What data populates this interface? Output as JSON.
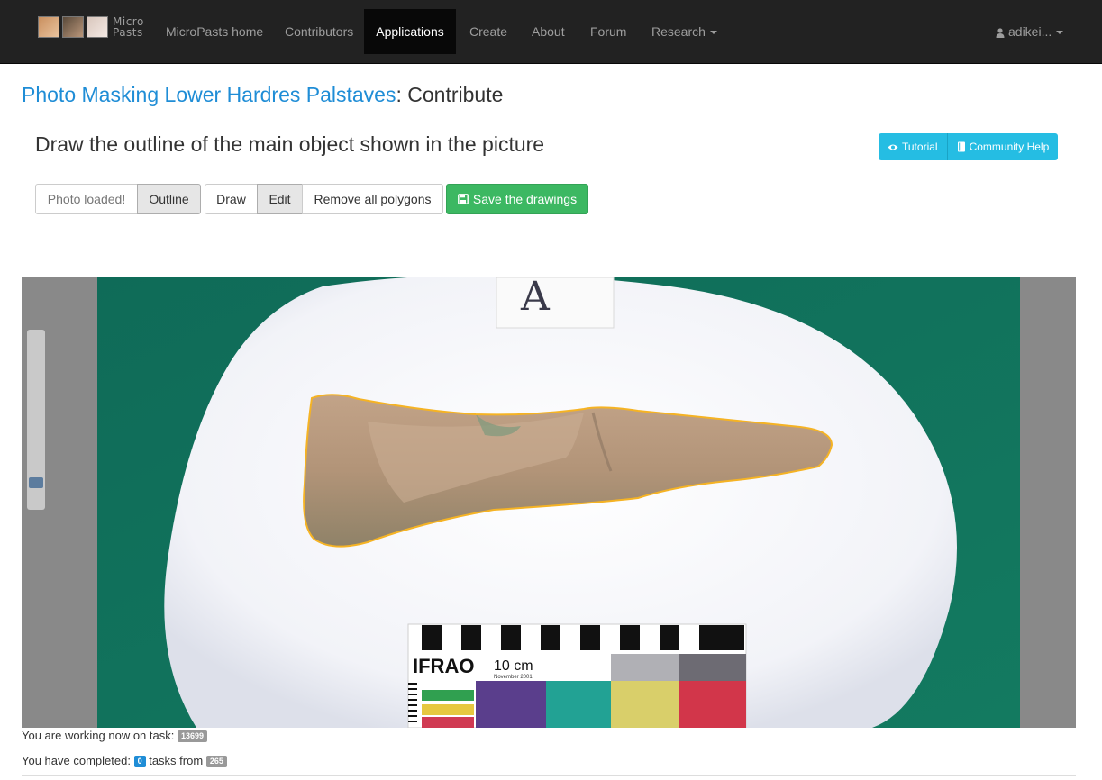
{
  "navbar": {
    "brand_text_top": "Micro",
    "brand_text_bottom": "Pasts",
    "items": [
      {
        "label": "MicroPasts home"
      },
      {
        "label": "Contributors"
      },
      {
        "label": "Applications",
        "active": true
      },
      {
        "label": "Create"
      },
      {
        "label": "About"
      },
      {
        "label": "Forum"
      },
      {
        "label": "Research"
      }
    ],
    "user": "adikei..."
  },
  "page": {
    "title_link": "Photo Masking Lower Hardres Palstaves",
    "title_suffix": ": Contribute",
    "instruction": "Draw the outline of the main object shown in the picture"
  },
  "help": {
    "tutorial": "Tutorial",
    "community": "Community Help"
  },
  "toolbar": {
    "status": "Photo loaded!",
    "outline": "Outline",
    "draw": "Draw",
    "edit": "Edit",
    "remove": "Remove all polygons",
    "save": "Save the drawings"
  },
  "photo": {
    "card_letter": "A",
    "scale_brand": "IFRAO",
    "scale_unit": "10 cm",
    "scale_date": "November 2001"
  },
  "progress": {
    "working_label": "You are working now on task:",
    "task_id": "13699",
    "completed_label": "You have completed:",
    "completed": "0",
    "tasks_from_label": "tasks from",
    "total": "265"
  },
  "colors": {
    "accent": "#1f8dd6",
    "info": "#25bde3",
    "success": "#3cb862",
    "outline": "#f5b324"
  }
}
